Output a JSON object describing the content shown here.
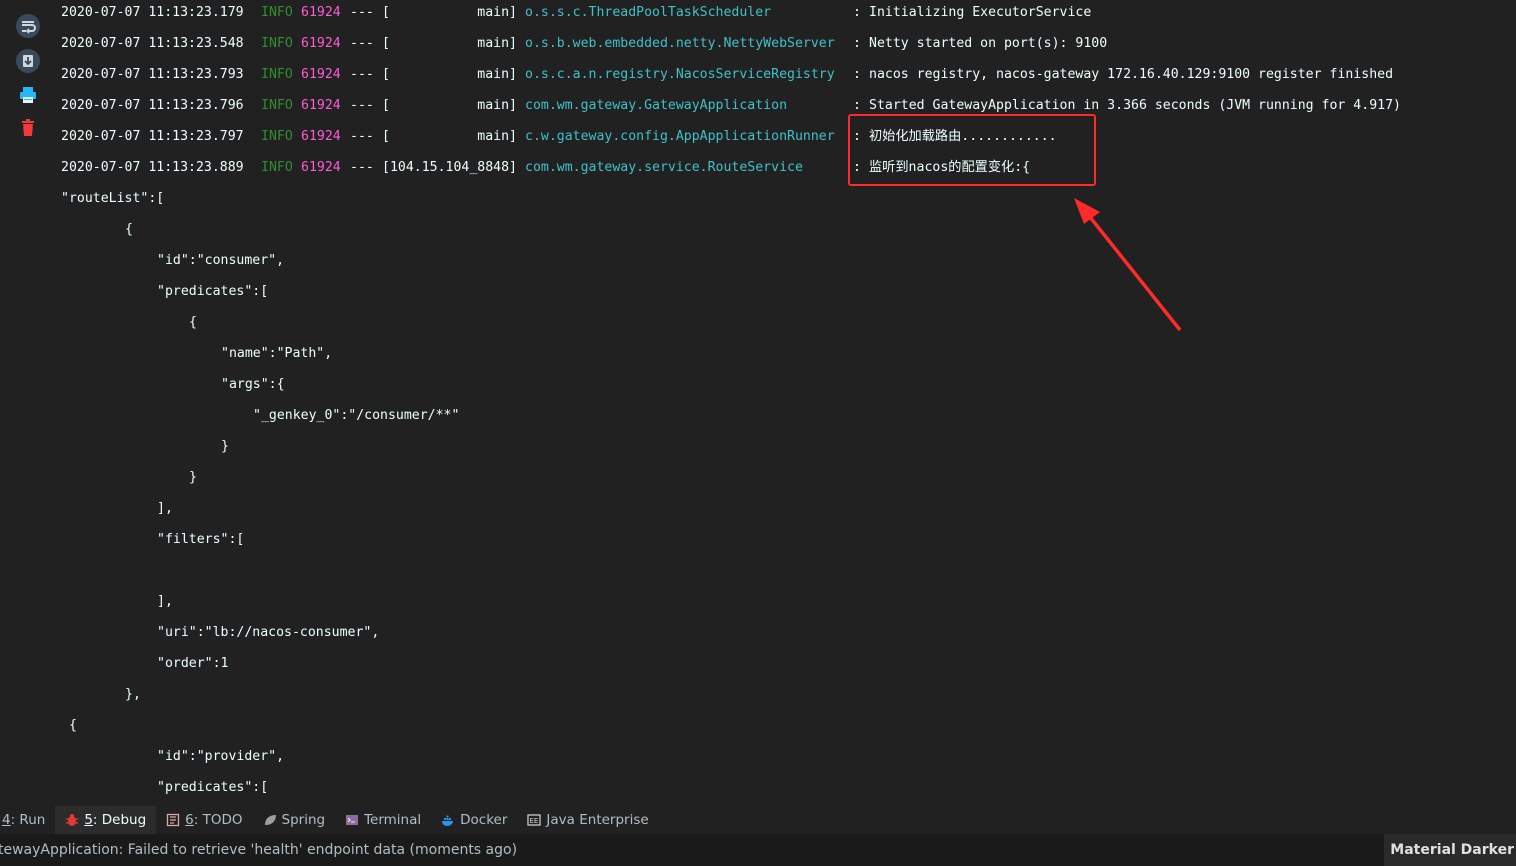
{
  "gutter": {
    "buttons": [
      {
        "icon": "soft-wrap-icon"
      },
      {
        "icon": "scroll-to-end-icon"
      },
      {
        "icon": "print-icon"
      },
      {
        "icon": "clear-all-icon"
      }
    ]
  },
  "console": {
    "log_lines": [
      {
        "ts": "2020-07-07 11:13:23.179",
        "level": "INFO",
        "pid": "61924",
        "sep": "---",
        "thread": "[           main]",
        "logger": "o.s.s.c.ThreadPoolTaskScheduler",
        "colon": ":",
        "msg": "Initializing ExecutorService"
      },
      {
        "ts": "2020-07-07 11:13:23.548",
        "level": "INFO",
        "pid": "61924",
        "sep": "---",
        "thread": "[           main]",
        "logger": "o.s.b.web.embedded.netty.NettyWebServer",
        "colon": ":",
        "msg": "Netty started on port(s): 9100"
      },
      {
        "ts": "2020-07-07 11:13:23.793",
        "level": "INFO",
        "pid": "61924",
        "sep": "---",
        "thread": "[           main]",
        "logger": "o.s.c.a.n.registry.NacosServiceRegistry",
        "colon": ":",
        "msg": "nacos registry, nacos-gateway 172.16.40.129:9100 register finished"
      },
      {
        "ts": "2020-07-07 11:13:23.796",
        "level": "INFO",
        "pid": "61924",
        "sep": "---",
        "thread": "[           main]",
        "logger": "com.wm.gateway.GatewayApplication",
        "colon": ":",
        "msg": "Started GatewayApplication in 3.366 seconds (JVM running for 4.917)"
      },
      {
        "ts": "2020-07-07 11:13:23.797",
        "level": "INFO",
        "pid": "61924",
        "sep": "---",
        "thread": "[           main]",
        "logger": "c.w.gateway.config.AppApplicationRunner",
        "colon": ":",
        "msg": "初始化加载路由............"
      },
      {
        "ts": "2020-07-07 11:13:23.889",
        "level": "INFO",
        "pid": "61924",
        "sep": "---",
        "thread": "[104.15.104_8848]",
        "logger": "com.wm.gateway.service.RouteService",
        "colon": ":",
        "msg": "监听到nacos的配置变化:{"
      }
    ],
    "json_lines": [
      {
        "indent": 0,
        "text": "\"routeList\":["
      },
      {
        "indent": 64,
        "text": "{"
      },
      {
        "indent": 96,
        "text": "\"id\":\"consumer\","
      },
      {
        "indent": 96,
        "text": "\"predicates\":["
      },
      {
        "indent": 128,
        "text": "{"
      },
      {
        "indent": 160,
        "text": "\"name\":\"Path\","
      },
      {
        "indent": 160,
        "text": "\"args\":{"
      },
      {
        "indent": 192,
        "text": "\"_genkey_0\":\"/consumer/**\""
      },
      {
        "indent": 160,
        "text": "}"
      },
      {
        "indent": 128,
        "text": "}"
      },
      {
        "indent": 96,
        "text": "],"
      },
      {
        "indent": 96,
        "text": "\"filters\":["
      },
      {
        "indent": 96,
        "text": ""
      },
      {
        "indent": 96,
        "text": "],"
      },
      {
        "indent": 96,
        "text": "\"uri\":\"lb://nacos-consumer\","
      },
      {
        "indent": 96,
        "text": "\"order\":1"
      },
      {
        "indent": 64,
        "text": "},"
      },
      {
        "indent": 8,
        "text": "{"
      },
      {
        "indent": 96,
        "text": "\"id\":\"provider\","
      },
      {
        "indent": 96,
        "text": "\"predicates\":["
      }
    ]
  },
  "tool_windows": [
    {
      "num": "4",
      "label": ": Run",
      "icon": "run-icon",
      "active": false
    },
    {
      "num": "5",
      "label": ": Debug",
      "icon": "debug-icon",
      "active": true
    },
    {
      "num": "6",
      "label": ": TODO",
      "icon": "todo-icon",
      "active": false
    },
    {
      "num": "",
      "label": "Spring",
      "icon": "spring-icon",
      "active": false
    },
    {
      "num": "",
      "label": "Terminal",
      "icon": "terminal-icon",
      "active": false
    },
    {
      "num": "",
      "label": "Docker",
      "icon": "docker-icon",
      "active": false
    },
    {
      "num": "",
      "label": "Java Enterprise",
      "icon": "java-enterprise-icon",
      "active": false
    }
  ],
  "status": {
    "message": "tewayApplication: Failed to retrieve 'health' endpoint data (moments ago)",
    "theme": "Material Darker"
  },
  "colors": {
    "background": "#212121",
    "info_level": "#2f8f2f",
    "pid": "#ff5cd6",
    "logger": "#3fc1c9",
    "annotation": "#ff2a2a"
  }
}
